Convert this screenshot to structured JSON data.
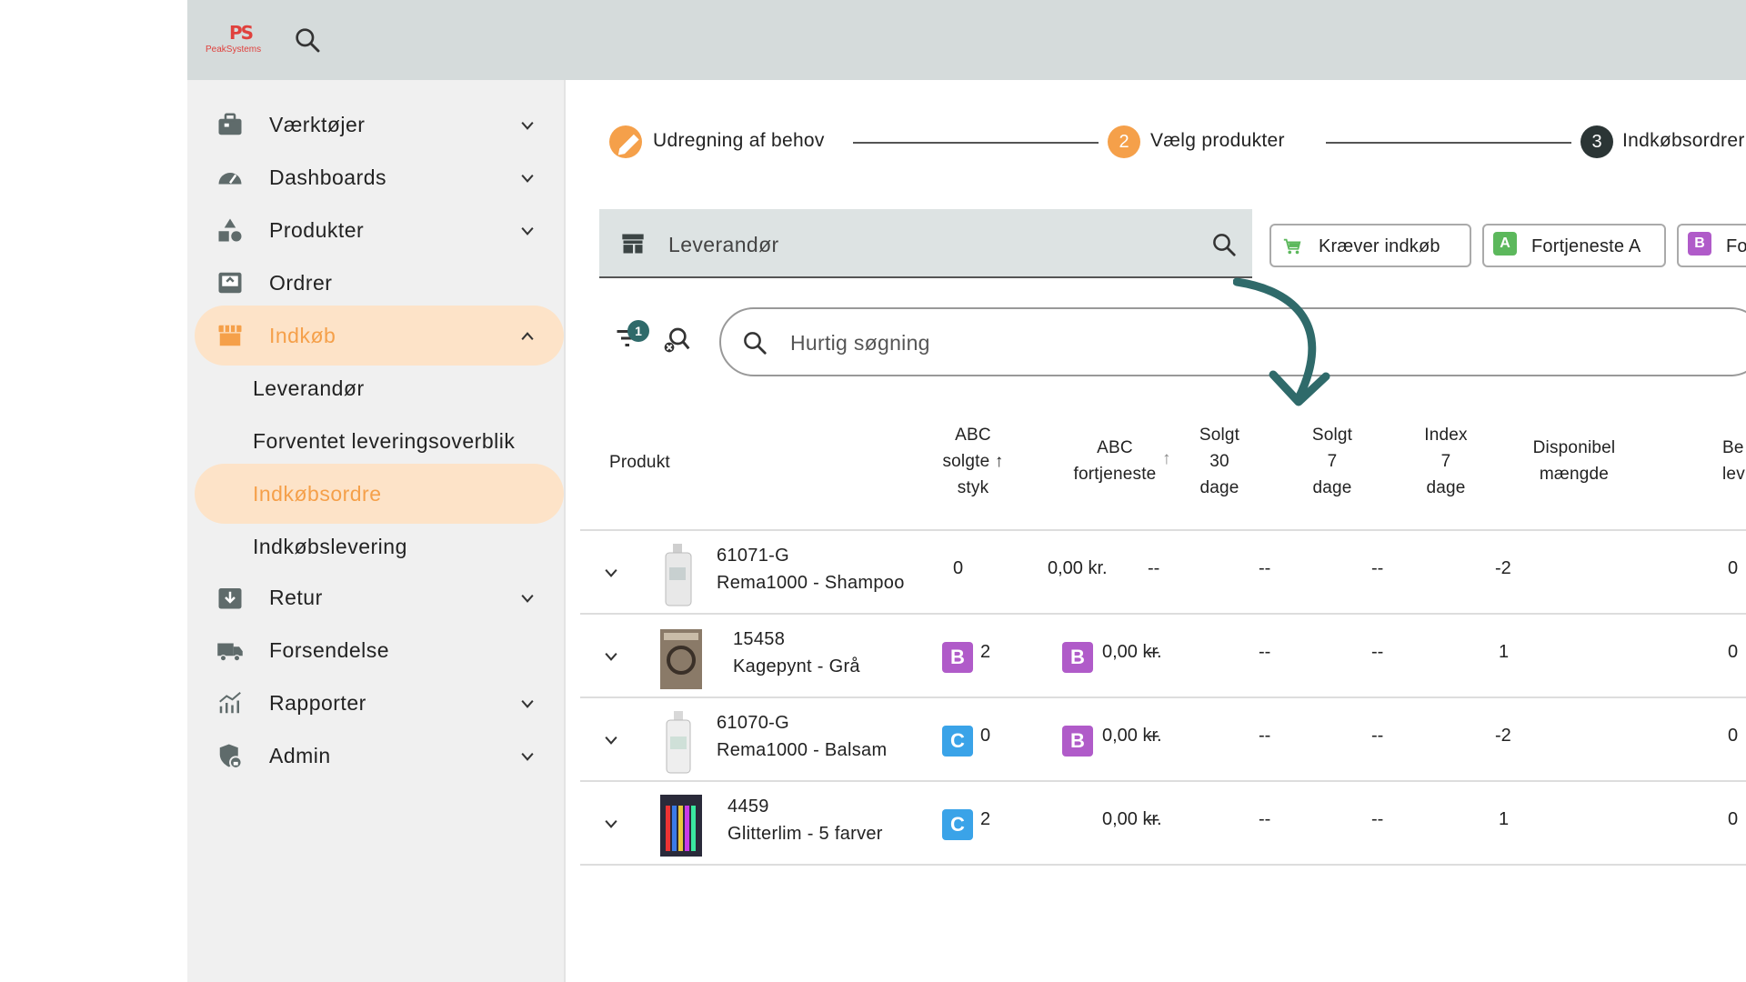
{
  "topbar": {
    "logo_mark": "PS",
    "logo_word": "PeakSystems"
  },
  "sidebar": {
    "items": [
      {
        "label": "Værktøjer"
      },
      {
        "label": "Dashboards"
      },
      {
        "label": "Produkter"
      },
      {
        "label": "Ordrer"
      },
      {
        "label": "Indkøb"
      },
      {
        "label": "Retur"
      },
      {
        "label": "Forsendelse"
      },
      {
        "label": "Rapporter"
      },
      {
        "label": "Admin"
      }
    ],
    "sub_items": [
      {
        "label": "Leverandør"
      },
      {
        "label": "Forventet leveringsoverblik"
      },
      {
        "label": "Indkøbsordre"
      },
      {
        "label": "Indkøbslevering"
      }
    ]
  },
  "stepper": {
    "steps": [
      {
        "number": "",
        "label": "Udregning af behov"
      },
      {
        "number": "2",
        "label": "Vælg produkter"
      },
      {
        "number": "3",
        "label": "Indkøbsordrer til"
      }
    ]
  },
  "supplier": {
    "label": "Leverandør"
  },
  "chips": [
    {
      "label": "Kræver indkøb"
    },
    {
      "badge": "A",
      "label": "Fortjeneste A"
    },
    {
      "badge": "B",
      "label": "For"
    }
  ],
  "filter": {
    "count": "1"
  },
  "quick_search": {
    "placeholder": "Hurtig søgning"
  },
  "table": {
    "headers": {
      "product": "Produkt",
      "abc_sold_1": "ABC",
      "abc_sold_2": "solgte",
      "abc_sold_3": "styk",
      "abc_profit_1": "ABC",
      "abc_profit_2": "fortjeneste",
      "sold30_1": "Solgt",
      "sold30_2": "30",
      "sold30_3": "dage",
      "sold7_1": "Solgt",
      "sold7_2": "7",
      "sold7_3": "dage",
      "index_1": "Index",
      "index_2": "7",
      "index_3": "dage",
      "avail_1": "Disponibel",
      "avail_2": "mængde",
      "last_1": "Be",
      "last_2": "lev"
    },
    "rows": [
      {
        "id": "61071-G",
        "name": "Rema1000 - Shampoo",
        "abc_sold_badge": "",
        "abc_sold": "0",
        "abc_profit_badge": "",
        "abc_profit": "0,00 kr.",
        "sold30": "--",
        "sold7": "--",
        "index7": "--",
        "available": "-2",
        "last": "0"
      },
      {
        "id": "15458",
        "name": "Kagepynt - Grå",
        "abc_sold_badge": "B",
        "abc_sold": "2",
        "abc_profit_badge": "B",
        "abc_profit": "0,00 kr.",
        "sold30": "--",
        "sold7": "--",
        "index7": "--",
        "available": "1",
        "last": "0"
      },
      {
        "id": "61070-G",
        "name": "Rema1000 - Balsam",
        "abc_sold_badge": "C",
        "abc_sold": "0",
        "abc_profit_badge": "B",
        "abc_profit": "0,00 kr.",
        "sold30": "--",
        "sold7": "--",
        "index7": "--",
        "available": "-2",
        "last": "0"
      },
      {
        "id": "4459",
        "name": "Glitterlim - 5 farver",
        "abc_sold_badge": "C",
        "abc_sold": "2",
        "abc_profit_badge": "",
        "abc_profit": "0,00 kr.",
        "sold30": "--",
        "sold7": "--",
        "index7": "--",
        "available": "1",
        "last": "0"
      }
    ]
  },
  "colors": {
    "accent_orange": "#f5a04a",
    "active_bg": "#fde3c8",
    "badge_a": "#5cb85c",
    "badge_b": "#b05bc9",
    "badge_c": "#3aa3e8",
    "arrow": "#2f6a6a"
  }
}
